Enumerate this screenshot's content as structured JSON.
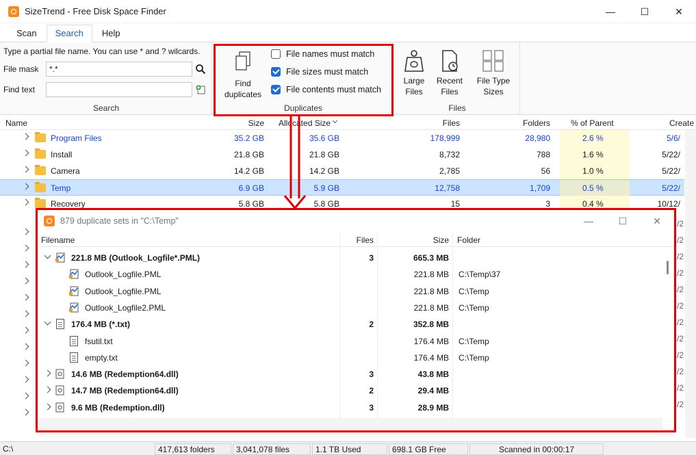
{
  "window": {
    "title": "SizeTrend - Free Disk Space Finder",
    "minimize": "—",
    "maximize": "☐",
    "close": "✕"
  },
  "tabs": [
    {
      "label": "Scan"
    },
    {
      "label": "Search"
    },
    {
      "label": "Help"
    }
  ],
  "search_group": {
    "hint": "Type a partial file name. You can use * and ? wilcards.",
    "file_mask_label": "File mask",
    "file_mask_value": "*.*",
    "find_text_label": "Find text",
    "find_text_value": "",
    "group_label": "Search"
  },
  "duplicates_group": {
    "find_button_line1": "Find",
    "find_button_line2": "duplicates",
    "options": [
      {
        "label": "File names must match",
        "checked": false
      },
      {
        "label": "File sizes must match",
        "checked": true
      },
      {
        "label": "File contents must match",
        "checked": true
      }
    ],
    "group_label": "Duplicates"
  },
  "files_group": {
    "buttons": [
      {
        "line1": "Large",
        "line2": "Files",
        "icon": "weight-icon"
      },
      {
        "line1": "Recent",
        "line2": "Files",
        "icon": "recent-file-icon"
      },
      {
        "line1": "File Type",
        "line2": "Sizes",
        "icon": "file-types-icon"
      }
    ],
    "group_label": "Files"
  },
  "main_list": {
    "columns": [
      "Name",
      "Size",
      "Allocated Size",
      "Files",
      "Folders",
      "% of Parent",
      "Create"
    ],
    "rows": [
      {
        "name": "Program Files",
        "size": "35.2 GB",
        "alloc": "35.6 GB",
        "files": "178,999",
        "folders": "28,980",
        "pct": "2.6 %",
        "created": "5/6/",
        "highlight": "blue"
      },
      {
        "name": "Install",
        "size": "21.8 GB",
        "alloc": "21.8 GB",
        "files": "8,732",
        "folders": "788",
        "pct": "1.6 %",
        "created": "5/22/",
        "highlight": ""
      },
      {
        "name": "Camera",
        "size": "14.2 GB",
        "alloc": "14.2 GB",
        "files": "2,785",
        "folders": "56",
        "pct": "1.0 %",
        "created": "5/22/",
        "highlight": ""
      },
      {
        "name": "Temp",
        "size": "6.9 GB",
        "alloc": "5.9 GB",
        "files": "12,758",
        "folders": "1,709",
        "pct": "0.5 %",
        "created": "5/22/",
        "highlight": "selected"
      },
      {
        "name": "Recovery",
        "size": "5.8 GB",
        "alloc": "5.8 GB",
        "files": "15",
        "folders": "3",
        "pct": "0.4 %",
        "created": "10/12/",
        "highlight": ""
      }
    ],
    "side_fragments": [
      "/2",
      "/2",
      "/2",
      "/2",
      "/2",
      "/2",
      "/2",
      "/2",
      "/2",
      "/2",
      "/2",
      "/2"
    ]
  },
  "child_window": {
    "title": "879 duplicate sets in \"C:\\Temp\"",
    "columns": [
      "Filename",
      "Files",
      "Size",
      "Folder"
    ],
    "rows": [
      {
        "level": 0,
        "expanded": true,
        "icon": "pml",
        "name": "221.8 MB (Outlook_Logfile*.PML)",
        "files": "3",
        "size": "665.3 MB",
        "folder": ""
      },
      {
        "level": 1,
        "icon": "pml",
        "name": "Outlook_Logfile.PML",
        "files": "",
        "size": "221.8 MB",
        "folder": "C:\\Temp\\37"
      },
      {
        "level": 1,
        "icon": "pml",
        "name": "Outlook_Logfile.PML",
        "files": "",
        "size": "221.8 MB",
        "folder": "C:\\Temp"
      },
      {
        "level": 1,
        "icon": "pml",
        "name": "Outlook_Logfile2.PML",
        "files": "",
        "size": "221.8 MB",
        "folder": "C:\\Temp"
      },
      {
        "level": 0,
        "expanded": true,
        "icon": "txt",
        "name": "176.4 MB (*.txt)",
        "files": "2",
        "size": "352.8 MB",
        "folder": ""
      },
      {
        "level": 1,
        "icon": "txt",
        "name": "fsutil.txt",
        "files": "",
        "size": "176.4 MB",
        "folder": "C:\\Temp"
      },
      {
        "level": 1,
        "icon": "txt",
        "name": "empty.txt",
        "files": "",
        "size": "176.4 MB",
        "folder": "C:\\Temp"
      },
      {
        "level": 0,
        "expanded": false,
        "icon": "dll",
        "name": "14.6 MB (Redemption64.dll)",
        "files": "3",
        "size": "43.8 MB",
        "folder": ""
      },
      {
        "level": 0,
        "expanded": false,
        "icon": "dll",
        "name": "14.7 MB (Redemption64.dll)",
        "files": "2",
        "size": "29.4 MB",
        "folder": ""
      },
      {
        "level": 0,
        "expanded": false,
        "icon": "dll",
        "name": "9.6 MB (Redemption.dll)",
        "files": "3",
        "size": "28.9 MB",
        "folder": ""
      }
    ]
  },
  "status_bar": {
    "path": "C:\\",
    "folders": "417,613 folders",
    "files": "3,041,078 files",
    "used": "1.1 TB Used",
    "free": "698.1 GB Free",
    "scanned": "Scanned in 00:00:17"
  },
  "colors": {
    "highlight_red": "#e00000",
    "link_blue": "#1a3fd0",
    "selection": "#cce4ff"
  }
}
